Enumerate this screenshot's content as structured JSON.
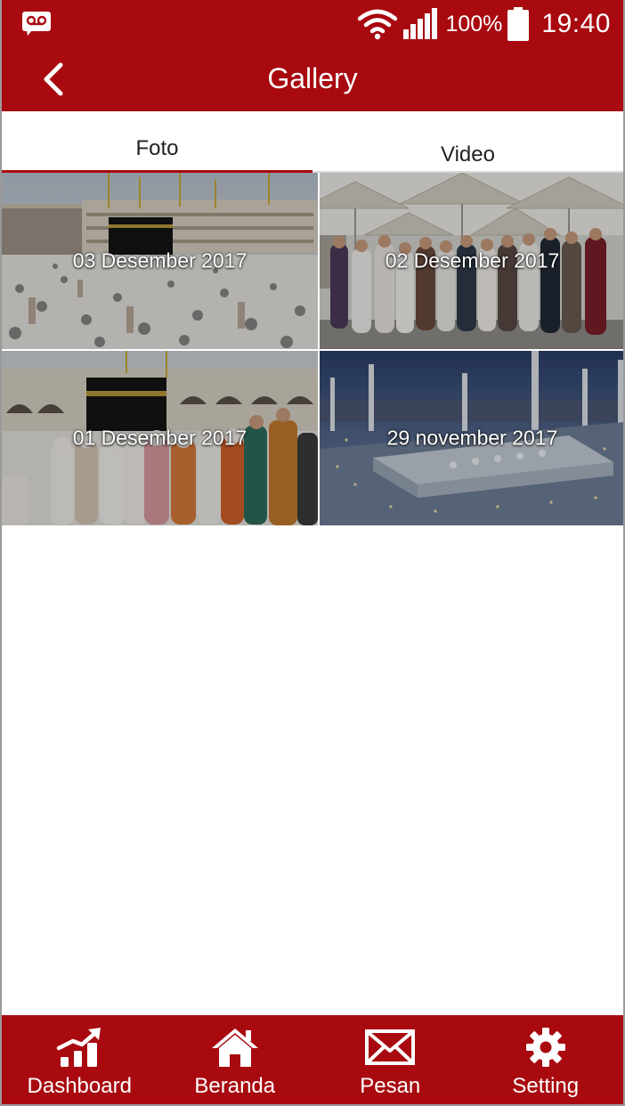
{
  "status_bar": {
    "notification_icon": "voicemail-icon",
    "wifi_icon": "wifi-icon",
    "signal_icon": "signal-icon",
    "battery_icon": "battery-icon",
    "battery_percent": "100%",
    "time": "19:40"
  },
  "toolbar": {
    "back_icon": "chevron-left-icon",
    "title": "Gallery"
  },
  "tabs": [
    {
      "label": "Foto",
      "active": true
    },
    {
      "label": "Video",
      "active": false
    }
  ],
  "gallery": {
    "albums": [
      {
        "caption": "03 Desember 2017"
      },
      {
        "caption": "02 Desember 2017"
      },
      {
        "caption": "01 Desember 2017"
      },
      {
        "caption": "29 november 2017"
      }
    ]
  },
  "bottom_nav": {
    "items": [
      {
        "label": "Dashboard",
        "icon": "chart-growth-icon"
      },
      {
        "label": "Beranda",
        "icon": "home-icon"
      },
      {
        "label": "Pesan",
        "icon": "envelope-icon"
      },
      {
        "label": "Setting",
        "icon": "gear-icon"
      }
    ]
  },
  "colors": {
    "primary": "#a80a10",
    "tab_indicator": "#a80a10",
    "background": "#ffffff"
  }
}
